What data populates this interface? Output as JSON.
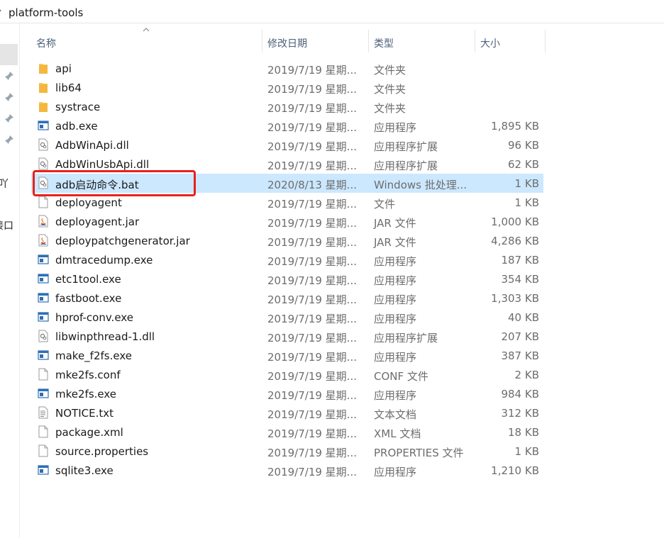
{
  "breadcrumb": {
    "arrow": "›",
    "folder": "platform-tools"
  },
  "nav_fragments": [
    "ı吖",
    "接口"
  ],
  "columns": {
    "name": "名称",
    "date": "修改日期",
    "type": "类型",
    "size": "大小"
  },
  "files": [
    {
      "name": "api",
      "date": "2019/7/19 星期...",
      "type": "文件夹",
      "size": "",
      "icon": "folder-icon",
      "selected": false
    },
    {
      "name": "lib64",
      "date": "2019/7/19 星期...",
      "type": "文件夹",
      "size": "",
      "icon": "folder-icon",
      "selected": false
    },
    {
      "name": "systrace",
      "date": "2019/7/19 星期...",
      "type": "文件夹",
      "size": "",
      "icon": "folder-icon",
      "selected": false
    },
    {
      "name": "adb.exe",
      "date": "2019/7/19 星期...",
      "type": "应用程序",
      "size": "1,895 KB",
      "icon": "exe-icon",
      "selected": false
    },
    {
      "name": "AdbWinApi.dll",
      "date": "2019/7/19 星期...",
      "type": "应用程序扩展",
      "size": "96 KB",
      "icon": "dll-icon",
      "selected": false
    },
    {
      "name": "AdbWinUsbApi.dll",
      "date": "2019/7/19 星期...",
      "type": "应用程序扩展",
      "size": "62 KB",
      "icon": "dll-icon",
      "selected": false
    },
    {
      "name": "adb启动命令.bat",
      "date": "2020/8/13 星期...",
      "type": "Windows 批处理...",
      "size": "1 KB",
      "icon": "bat-icon",
      "selected": true
    },
    {
      "name": "deployagent",
      "date": "2019/7/19 星期...",
      "type": "文件",
      "size": "1 KB",
      "icon": "file-icon",
      "selected": false
    },
    {
      "name": "deployagent.jar",
      "date": "2019/7/19 星期...",
      "type": "JAR 文件",
      "size": "1,000 KB",
      "icon": "jar-icon",
      "selected": false
    },
    {
      "name": "deploypatchgenerator.jar",
      "date": "2019/7/19 星期...",
      "type": "JAR 文件",
      "size": "4,286 KB",
      "icon": "jar-icon",
      "selected": false
    },
    {
      "name": "dmtracedump.exe",
      "date": "2019/7/19 星期...",
      "type": "应用程序",
      "size": "187 KB",
      "icon": "exe-icon",
      "selected": false
    },
    {
      "name": "etc1tool.exe",
      "date": "2019/7/19 星期...",
      "type": "应用程序",
      "size": "354 KB",
      "icon": "exe-icon",
      "selected": false
    },
    {
      "name": "fastboot.exe",
      "date": "2019/7/19 星期...",
      "type": "应用程序",
      "size": "1,303 KB",
      "icon": "exe-icon",
      "selected": false
    },
    {
      "name": "hprof-conv.exe",
      "date": "2019/7/19 星期...",
      "type": "应用程序",
      "size": "40 KB",
      "icon": "exe-icon",
      "selected": false
    },
    {
      "name": "libwinpthread-1.dll",
      "date": "2019/7/19 星期...",
      "type": "应用程序扩展",
      "size": "207 KB",
      "icon": "dll-icon",
      "selected": false
    },
    {
      "name": "make_f2fs.exe",
      "date": "2019/7/19 星期...",
      "type": "应用程序",
      "size": "387 KB",
      "icon": "exe-icon",
      "selected": false
    },
    {
      "name": "mke2fs.conf",
      "date": "2019/7/19 星期...",
      "type": "CONF 文件",
      "size": "2 KB",
      "icon": "file-icon",
      "selected": false
    },
    {
      "name": "mke2fs.exe",
      "date": "2019/7/19 星期...",
      "type": "应用程序",
      "size": "984 KB",
      "icon": "exe-icon",
      "selected": false
    },
    {
      "name": "NOTICE.txt",
      "date": "2019/7/19 星期...",
      "type": "文本文档",
      "size": "312 KB",
      "icon": "txt-icon",
      "selected": false
    },
    {
      "name": "package.xml",
      "date": "2019/7/19 星期...",
      "type": "XML 文档",
      "size": "18 KB",
      "icon": "file-icon",
      "selected": false
    },
    {
      "name": "source.properties",
      "date": "2019/7/19 星期...",
      "type": "PROPERTIES 文件",
      "size": "1 KB",
      "icon": "file-icon",
      "selected": false
    },
    {
      "name": "sqlite3.exe",
      "date": "2019/7/19 星期...",
      "type": "应用程序",
      "size": "1,210 KB",
      "icon": "exe-icon",
      "selected": false
    }
  ],
  "colors": {
    "selection": "#cce8ff",
    "highlight_border": "#e8221b",
    "folder": "#f8c85c",
    "header_text": "#4c607a"
  }
}
